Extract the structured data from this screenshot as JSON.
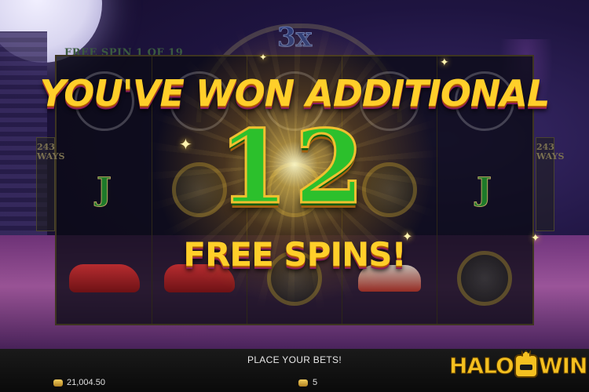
{
  "game": {
    "multiplier": "3x",
    "free_spin_counter": "FREE SPIN  1  OF 19",
    "ways_left": [
      "243",
      "WAYS"
    ],
    "ways_right": [
      "243",
      "WAYS"
    ]
  },
  "popup": {
    "headline": "YOU'VE WON ADDITIONAL",
    "number": "12",
    "subline": "FREE SPINS!"
  },
  "reels": [
    {
      "symbols": [
        "swirl",
        "J",
        "car"
      ]
    },
    {
      "symbols": [
        "swirl",
        "safe",
        "car"
      ]
    },
    {
      "symbols": [
        "swirl",
        "safe",
        "safe"
      ]
    },
    {
      "symbols": [
        "swirl",
        "safe",
        "plane"
      ]
    },
    {
      "symbols": [
        "swirl",
        "J",
        "safe"
      ]
    }
  ],
  "reel_j_symbol": "J",
  "bottom_bar": {
    "status": "PLACE YOUR BETS!",
    "balance": "21,004.50",
    "bet": "5",
    "balance_icon": "coins-icon",
    "bet_icon": "coin-stack-icon"
  },
  "logo": {
    "left": "HALO",
    "right": "WIN"
  },
  "colors": {
    "title_gold": "#ffcf2a",
    "number_green": "#2cc02c",
    "bar_bg": "#0a0a0a"
  }
}
